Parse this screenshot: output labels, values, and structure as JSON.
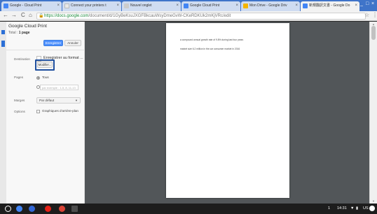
{
  "browser": {
    "tabs": [
      {
        "title": "Google - Cloud Print",
        "favicon_color": "#4285f4",
        "active": false
      },
      {
        "title": "Connect your printers t",
        "favicon_color": "#dddddd",
        "active": false
      },
      {
        "title": "Nouvel onglet",
        "favicon_color": "#cccccc",
        "active": false
      },
      {
        "title": "Google Cloud Print",
        "favicon_color": "#4285f4",
        "active": false
      },
      {
        "title": "Mon Drive - Google Driv",
        "favicon_color": "#f4b400",
        "active": false
      },
      {
        "title": "新規翻訳文書 - Google Do",
        "favicon_color": "#4285f4",
        "active": true
      }
    ],
    "url_host": "https://docs.google.com",
    "url_path": "/document/d/1GyBeKsuJXGFBkcauWsyDmeGvW-CKeRDKUk2mKjVRc/edit",
    "window_controls": [
      "_",
      "□",
      "×"
    ]
  },
  "print": {
    "title": "Google Cloud Print",
    "total_label": "Total : ",
    "total_value": "1 page",
    "save_label": "Enregistrer",
    "cancel_label": "Annuler",
    "destination_label": "Destination",
    "destination_name": "Enregistrer au format ...",
    "modify_label": "Modifier...",
    "pages_label": "Pages",
    "pages_all": "Tous",
    "pages_placeholder": "par exemple : 1-5, 8, 11-13",
    "margins_label": "Marges",
    "margins_value": "Par défaut",
    "options_label": "Options",
    "background_graphics": "Graphiques d'arrière-plan"
  },
  "preview": {
    "line1": "a compound annual growth rate of 9.8% during last four years",
    "line2": "market size 6.2 million in the car consumer market in 2016"
  },
  "shelf": {
    "apps": [
      {
        "name": "launcher",
        "color": "#ffffff"
      },
      {
        "name": "chrome",
        "color": "#4285f4"
      },
      {
        "name": "files",
        "color": "#3367d6"
      },
      {
        "name": "youtube",
        "color": "#e62117"
      },
      {
        "name": "gmail",
        "color": "#db4437"
      },
      {
        "name": "docs",
        "color": "#4d4d4d"
      }
    ],
    "page_badge": "1",
    "time": "14:31",
    "locale": "US"
  }
}
